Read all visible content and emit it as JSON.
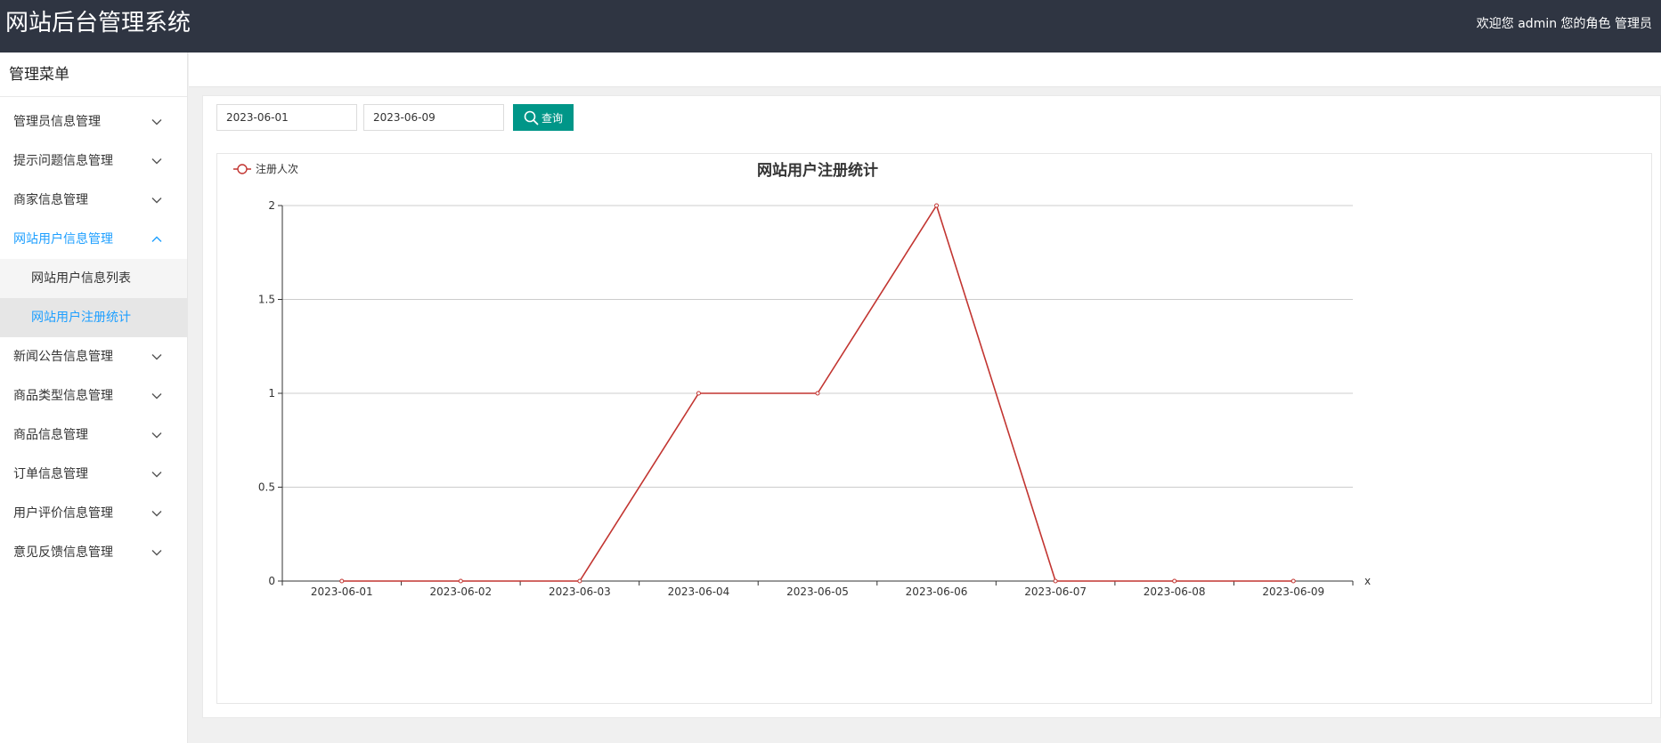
{
  "header": {
    "title": "网站后台管理系统",
    "user_info": "欢迎您 admin 您的角色 管理员"
  },
  "sidebar": {
    "title": "管理菜单",
    "items": [
      {
        "label": "管理员信息管理",
        "expanded": false
      },
      {
        "label": "提示问题信息管理",
        "expanded": false
      },
      {
        "label": "商家信息管理",
        "expanded": false
      },
      {
        "label": "网站用户信息管理",
        "expanded": true,
        "children": [
          {
            "label": "网站用户信息列表",
            "active": false
          },
          {
            "label": "网站用户注册统计",
            "active": true
          }
        ]
      },
      {
        "label": "新闻公告信息管理",
        "expanded": false
      },
      {
        "label": "商品类型信息管理",
        "expanded": false
      },
      {
        "label": "商品信息管理",
        "expanded": false
      },
      {
        "label": "订单信息管理",
        "expanded": false
      },
      {
        "label": "用户评价信息管理",
        "expanded": false
      },
      {
        "label": "意见反馈信息管理",
        "expanded": false
      }
    ]
  },
  "filters": {
    "start_date": "2023-06-01",
    "end_date": "2023-06-09",
    "query_label": "查询"
  },
  "colors": {
    "header_bg": "#2f3542",
    "accent": "#1e9fff",
    "button": "#009688",
    "series": "#c23531"
  },
  "icons": {
    "search": "search-icon",
    "chevron_down": "chevron-down-icon",
    "chevron_up": "chevron-up-icon"
  },
  "chart_data": {
    "type": "line",
    "title": "网站用户注册统计",
    "xlabel": "x",
    "ylabel": "",
    "categories": [
      "2023-06-01",
      "2023-06-02",
      "2023-06-03",
      "2023-06-04",
      "2023-06-05",
      "2023-06-06",
      "2023-06-07",
      "2023-06-08",
      "2023-06-09"
    ],
    "series": [
      {
        "name": "注册人次",
        "values": [
          0,
          0,
          0,
          1,
          1,
          2,
          0,
          0,
          0
        ]
      }
    ],
    "ylim": [
      0,
      2
    ],
    "yticks": [
      0,
      0.5,
      1,
      1.5,
      2
    ],
    "grid": true,
    "legend_position": "top-left"
  }
}
